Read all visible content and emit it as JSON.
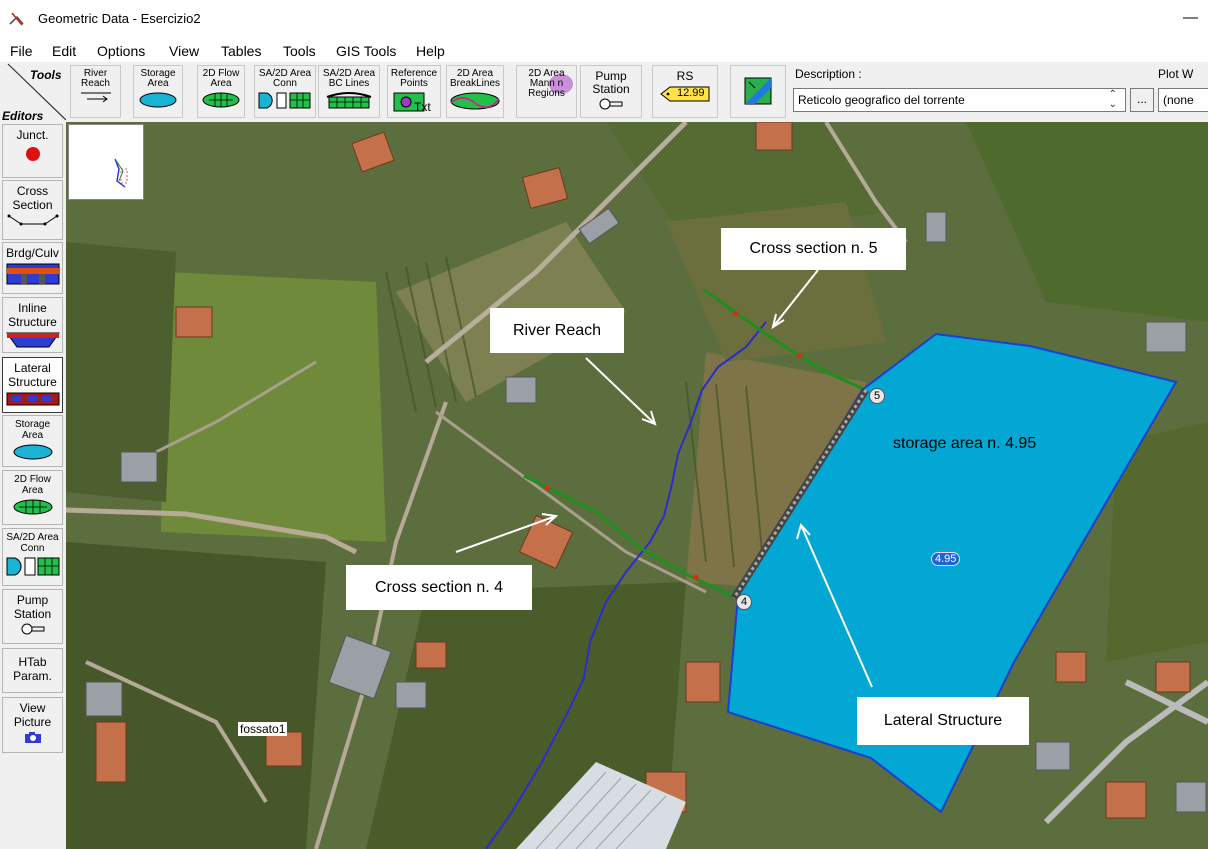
{
  "window": {
    "title": "Geometric Data - Esercizio2",
    "minimize": "—"
  },
  "menu": [
    "File",
    "Edit",
    "Options",
    "View",
    "Tables",
    "Tools",
    "GIS Tools",
    "Help"
  ],
  "toolbar": {
    "tools_label": "Tools",
    "editors_label": "Editors",
    "buttons": [
      {
        "label": "River\nReach",
        "icon": "river-reach-arrow-icon"
      },
      {
        "label": "Storage\nArea",
        "icon": "storage-area-icon"
      },
      {
        "label": "2D Flow\nArea",
        "icon": "2d-flow-area-icon"
      },
      {
        "label": "SA/2D Area\nConn",
        "icon": "sa-2d-conn-icon"
      },
      {
        "label": "SA/2D Area\nBC Lines",
        "icon": "bc-lines-icon"
      },
      {
        "label": "Reference\nPoints",
        "icon": "reference-points-icon",
        "extra": "Txt"
      },
      {
        "label": "2D Area\nBreakLines",
        "icon": "breaklines-icon"
      },
      {
        "label": "2D Area\nMann n\nRegions",
        "icon": "mann-n-regions-icon"
      },
      {
        "label": "Pump\nStation",
        "icon": "pump-station-icon"
      },
      {
        "label": "RS",
        "icon": "rs-tag-icon",
        "value": "12.99"
      },
      {
        "label": "",
        "icon": "map-background-icon"
      }
    ],
    "description_label": "Description :",
    "description_value": "Reticolo geografico del torrente",
    "ellipsis": "...",
    "plot_label": "Plot W",
    "plot_value": "(none"
  },
  "sidebar": [
    {
      "label": "Junct.",
      "icon": "junction-icon"
    },
    {
      "label": "Cross\nSection",
      "icon": "cross-section-icon"
    },
    {
      "label": "Brdg/Culv",
      "icon": "bridge-culvert-icon"
    },
    {
      "label": "Inline\nStructure",
      "icon": "inline-structure-icon"
    },
    {
      "label": "Lateral\nStructure",
      "icon": "lateral-structure-icon",
      "active": true
    },
    {
      "label": "Storage\nArea",
      "icon": "storage-area-icon"
    },
    {
      "label": "2D Flow\nArea",
      "icon": "2d-flow-area-icon"
    },
    {
      "label": "SA/2D Area\nConn",
      "icon": "sa-2d-conn-icon"
    },
    {
      "label": "Pump\nStation",
      "icon": "pump-station-icon"
    },
    {
      "label": "HTab\nParam.",
      "icon": ""
    },
    {
      "label": "View\nPicture",
      "icon": "camera-icon"
    }
  ],
  "map": {
    "callouts": {
      "cross_section_5": "Cross section n. 5",
      "river_reach": "River Reach",
      "storage_area": "storage area n. 4.95",
      "cross_section_4": "Cross section n. 4",
      "lateral_structure": "Lateral Structure"
    },
    "storage_tag": "4.95",
    "xs_label_5": "5",
    "xs_label_4": "4",
    "stream_label": "fossato1",
    "colors": {
      "storage_fill": "#02a7d4",
      "storage_outline": "#1a3fd1",
      "river": "#2b2bd0",
      "cross_section": "#1f8f1f",
      "lateral": "#555555"
    }
  }
}
